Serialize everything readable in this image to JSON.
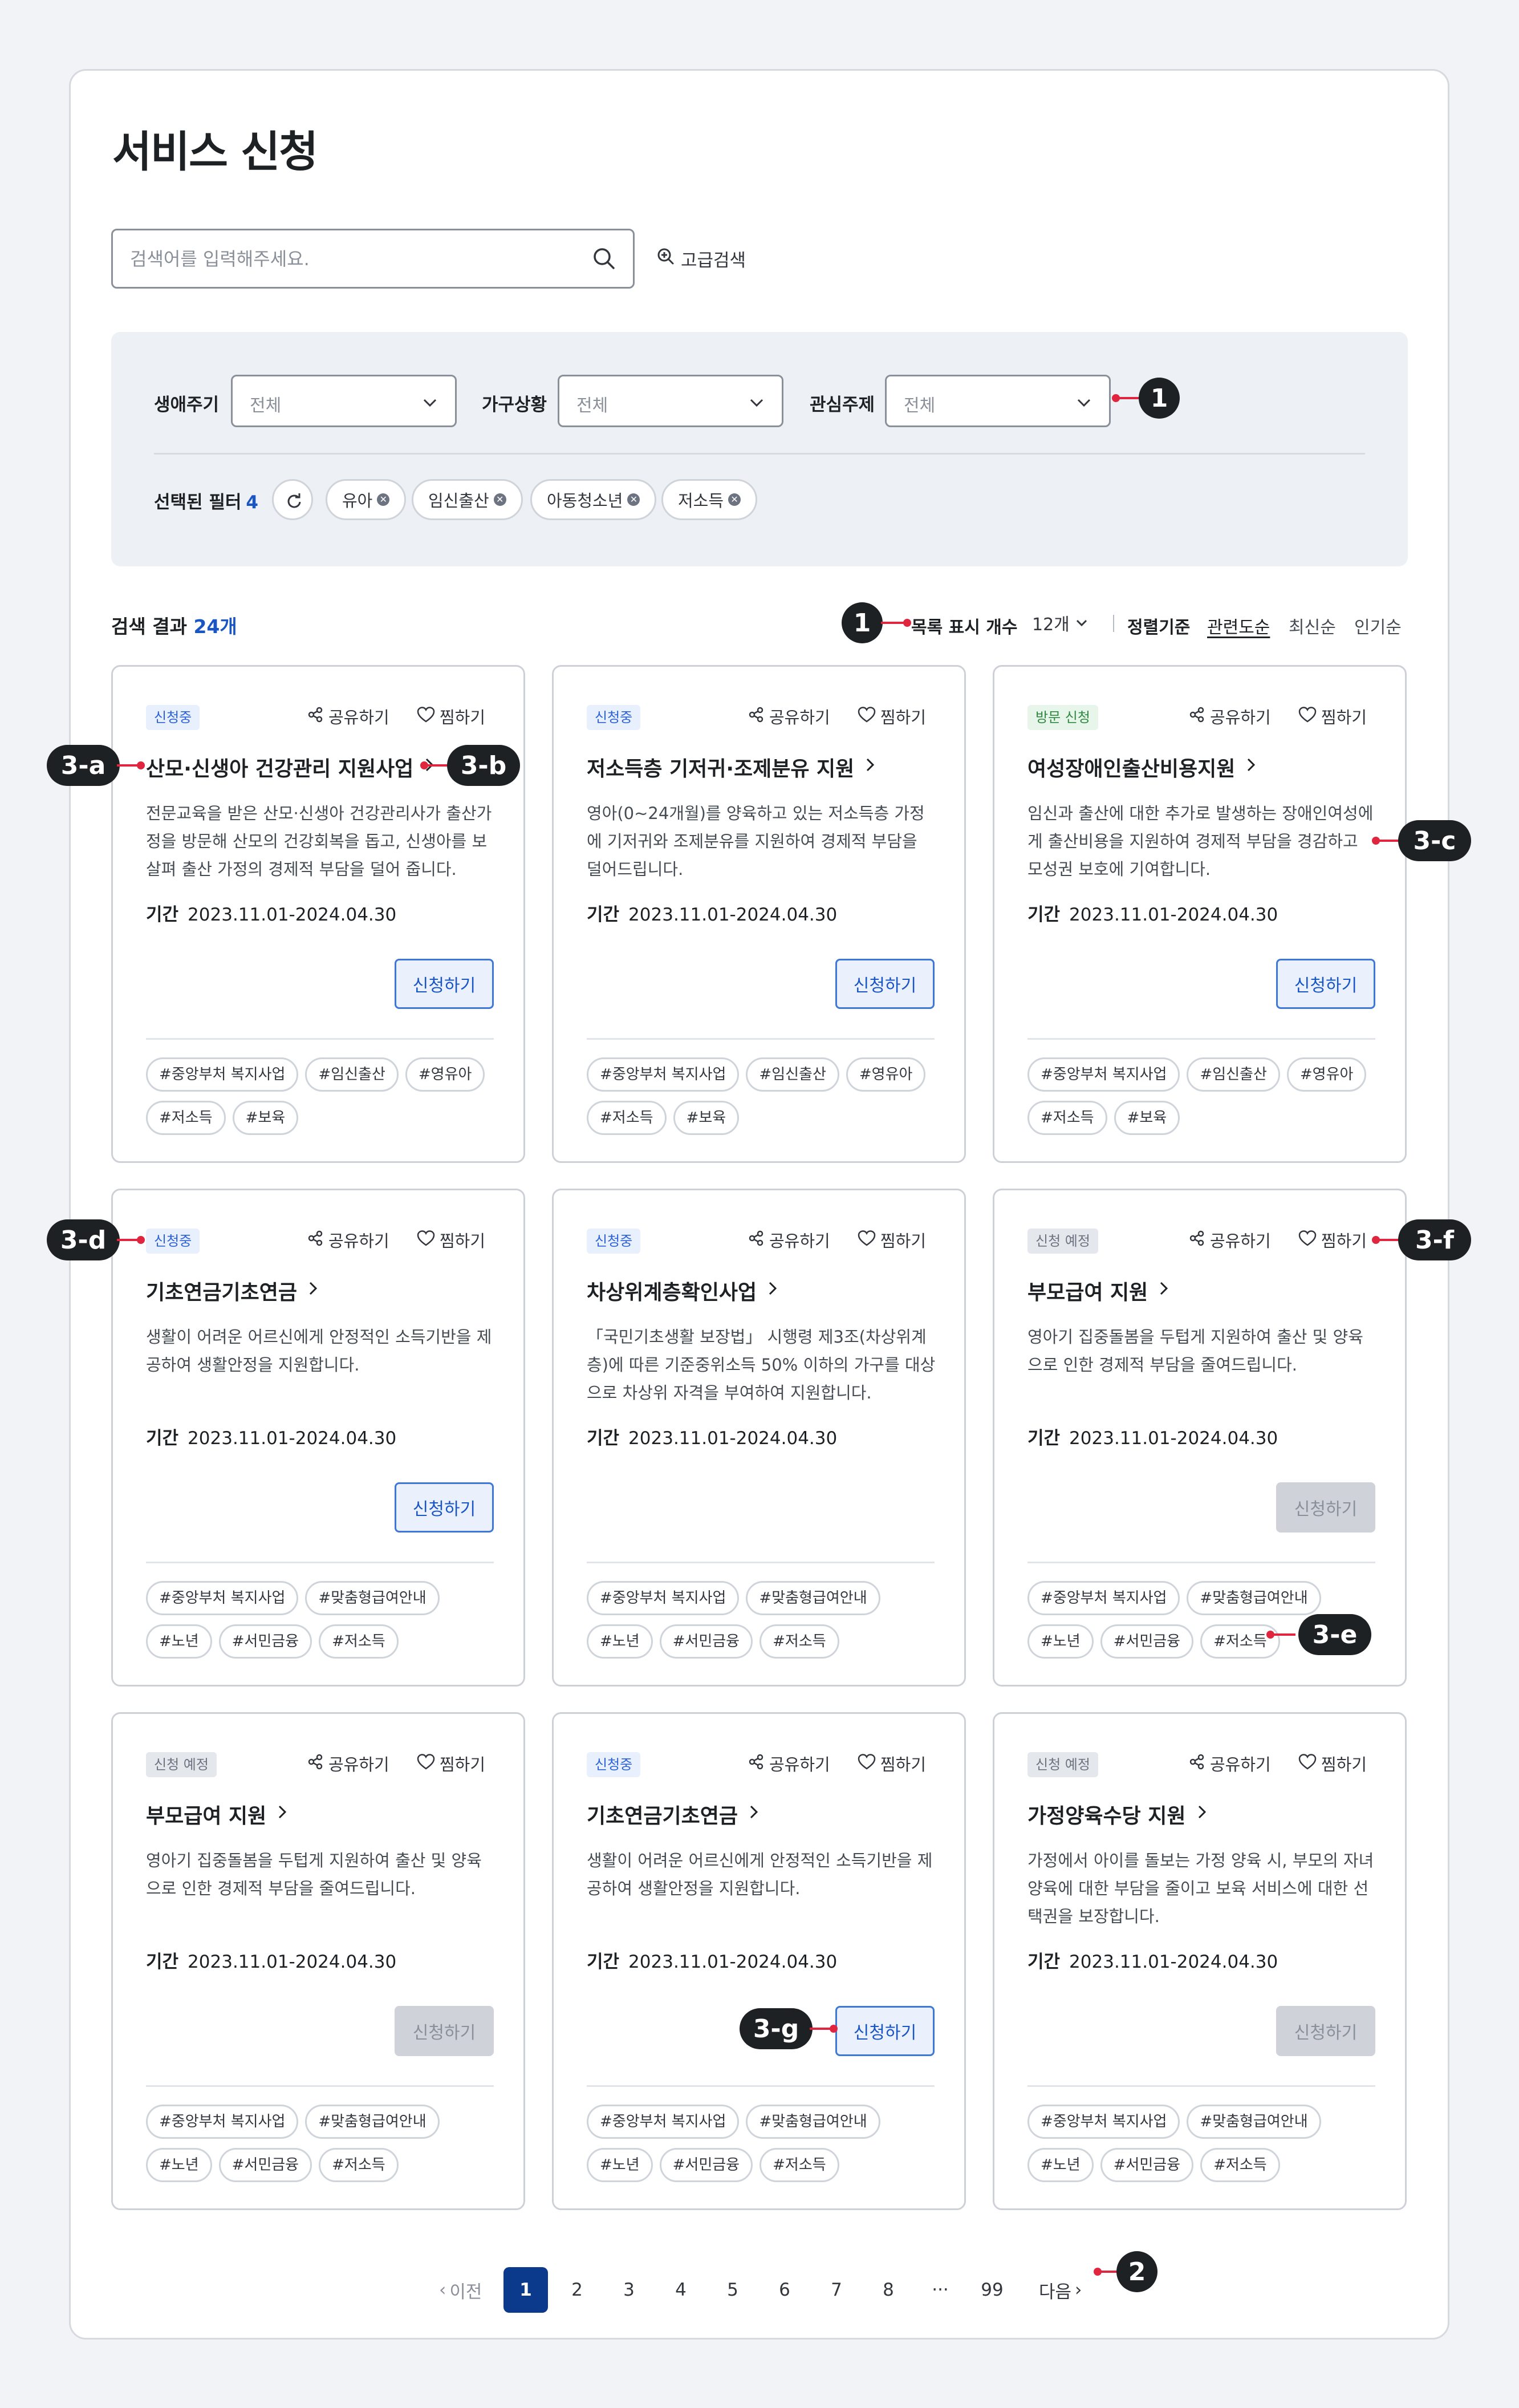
{
  "page": {
    "title": "서비스 신청"
  },
  "search": {
    "placeholder": "검색어를 입력해주세요.",
    "advanced_label": "고급검색"
  },
  "filters": {
    "life_cycle": {
      "label": "생애주기",
      "value": "전체"
    },
    "household": {
      "label": "가구상황",
      "value": "전체"
    },
    "interest": {
      "label": "관심주제",
      "value": "전체"
    },
    "selected_label": "선택된 필터",
    "selected_count": "4",
    "chips": [
      "유아",
      "임신출산",
      "아동청소년",
      "저소득"
    ]
  },
  "results": {
    "count_prefix": "검색 결과",
    "count": "24개",
    "list_size_label": "목록 표시 개수",
    "list_size_value": "12개",
    "sort_label": "정렬기준",
    "sort_options": [
      "관련도순",
      "최신순",
      "인기순"
    ],
    "active_sort": "관련도순"
  },
  "card_labels": {
    "share": "공유하기",
    "like": "찜하기",
    "period": "기간",
    "apply": "신청하기"
  },
  "cards": [
    {
      "status": "신청중",
      "status_type": "blue",
      "title": "산모·신생아 건강관리 지원사업",
      "desc": "전문교육을 받은 산모·신생아 건강관리사가 출산가정을 방문해 산모의 건강회복을 돕고, 신생아를 보살펴 출산 가정의 경제적 부담을 덜어 줍니다.",
      "period": "2023.11.01-2024.04.30",
      "apply_enabled": true,
      "tags": [
        "#중앙부처 복지사업",
        "#임신출산",
        "#영유아",
        "#저소득",
        "#보육"
      ]
    },
    {
      "status": "신청중",
      "status_type": "blue",
      "title": "저소득층 기저귀·조제분유 지원",
      "desc": "영아(0~24개월)를 양육하고 있는 저소득층 가정에 기저귀와 조제분유를 지원하여 경제적 부담을 덜어드립니다.",
      "period": "2023.11.01-2024.04.30",
      "apply_enabled": true,
      "tags": [
        "#중앙부처 복지사업",
        "#임신출산",
        "#영유아",
        "#저소득",
        "#보육"
      ]
    },
    {
      "status": "방문 신청",
      "status_type": "green",
      "title": "여성장애인출산비용지원",
      "desc": "임신과 출산에 대한 추가로 발생하는 장애인여성에게 출산비용을 지원하여 경제적 부담을 경감하고 모성권 보호에 기여합니다.",
      "period": "2023.11.01-2024.04.30",
      "apply_enabled": true,
      "tags": [
        "#중앙부처 복지사업",
        "#임신출산",
        "#영유아",
        "#저소득",
        "#보육"
      ]
    },
    {
      "status": "신청중",
      "status_type": "blue",
      "title": "기초연금기초연금",
      "desc": "생활이 어려운 어르신에게 안정적인 소득기반을 제공하여 생활안정을 지원합니다.",
      "period": "2023.11.01-2024.04.30",
      "apply_enabled": true,
      "tags": [
        "#중앙부처 복지사업",
        "#맞춤형급여안내",
        "#노년",
        "#서민금융",
        "#저소득"
      ]
    },
    {
      "status": "신청중",
      "status_type": "blue",
      "title": "차상위계층확인사업",
      "desc": "「국민기초생활 보장법」 시행령 제3조(차상위계층)에 따른 기준중위소득 50% 이하의 가구를 대상으로 차상위 자격을 부여하여 지원합니다.",
      "period": "2023.11.01-2024.04.30",
      "apply_enabled": null,
      "tags": [
        "#중앙부처 복지사업",
        "#맞춤형급여안내",
        "#노년",
        "#서민금융",
        "#저소득"
      ]
    },
    {
      "status": "신청 예정",
      "status_type": "gray",
      "title": "부모급여 지원",
      "desc": "영아기 집중돌봄을 두텁게 지원하여 출산 및 양육으로 인한 경제적 부담을 줄여드립니다.",
      "period": "2023.11.01-2024.04.30",
      "apply_enabled": false,
      "tags": [
        "#중앙부처 복지사업",
        "#맞춤형급여안내",
        "#노년",
        "#서민금융",
        "#저소득"
      ]
    },
    {
      "status": "신청 예정",
      "status_type": "gray",
      "title": "부모급여 지원",
      "desc": "영아기 집중돌봄을 두텁게 지원하여 출산 및 양육으로 인한 경제적 부담을 줄여드립니다.",
      "period": "2023.11.01-2024.04.30",
      "apply_enabled": false,
      "tags": [
        "#중앙부처 복지사업",
        "#맞춤형급여안내",
        "#노년",
        "#서민금융",
        "#저소득"
      ]
    },
    {
      "status": "신청중",
      "status_type": "blue",
      "title": "기초연금기초연금",
      "desc": "생활이 어려운 어르신에게 안정적인 소득기반을 제공하여 생활안정을 지원합니다.",
      "period": "2023.11.01-2024.04.30",
      "apply_enabled": true,
      "tags": [
        "#중앙부처 복지사업",
        "#맞춤형급여안내",
        "#노년",
        "#서민금융",
        "#저소득"
      ]
    },
    {
      "status": "신청 예정",
      "status_type": "gray",
      "title": "가정양육수당 지원",
      "desc": "가정에서 아이를 돌보는 가정 양육 시, 부모의 자녀 양육에 대한 부담을 줄이고 보육 서비스에 대한 선택권을 보장합니다.",
      "period": "2023.11.01-2024.04.30",
      "apply_enabled": false,
      "tags": [
        "#중앙부처 복지사업",
        "#맞춤형급여안내",
        "#노년",
        "#서민금융",
        "#저소득"
      ]
    }
  ],
  "pagination": {
    "prev": "이전",
    "next": "다음",
    "pages": [
      "1",
      "2",
      "3",
      "4",
      "5",
      "6",
      "7",
      "8"
    ],
    "ellipsis": "···",
    "last": "99",
    "current": "1"
  },
  "annotations": {
    "m1": "1",
    "m2": "2",
    "m3a": "3-a",
    "m3b": "3-b",
    "m3c": "3-c",
    "m3d": "3-d",
    "m3e": "3-e",
    "m3f": "3-f",
    "m3g": "3-g"
  },
  "colors": {
    "accent": "#1a55c4",
    "active_page": "#0b3a8c",
    "marker_line": "#e0263f",
    "marker_badge": "#1e2124"
  }
}
